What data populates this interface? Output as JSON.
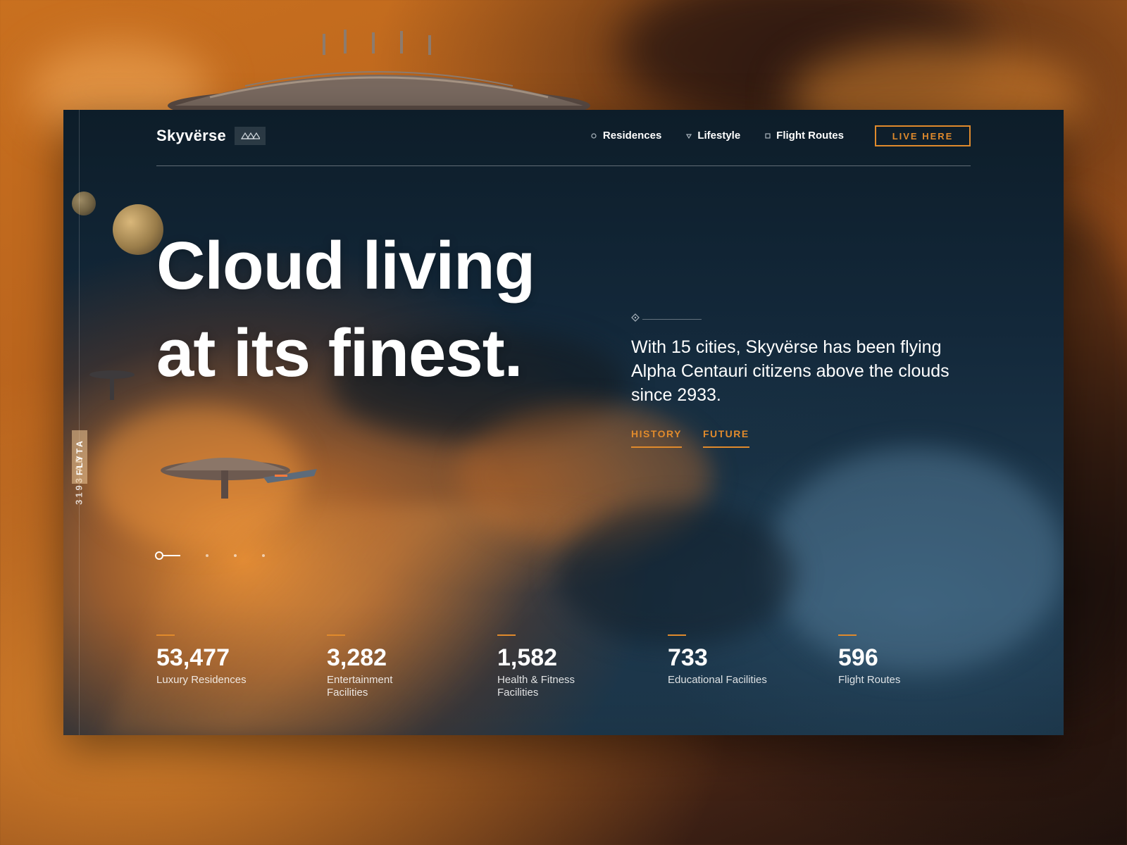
{
  "brand": {
    "name": "Skyvërse",
    "badge_icon": "triangles-icon"
  },
  "nav": {
    "items": [
      {
        "label": "Residences",
        "icon": "circle-icon"
      },
      {
        "label": "Lifestyle",
        "icon": "triangle-down-icon"
      },
      {
        "label": "Flight Routes",
        "icon": "square-icon"
      }
    ],
    "cta_label": "LIVE HERE"
  },
  "side": {
    "year": "3193 AD",
    "tag": "FLYTA"
  },
  "hero": {
    "headline_line1": "Cloud living",
    "headline_line2": "at its finest.",
    "blurb": "With 15 cities, Skyvërse has been flying Alpha Centauri citizens above the clouds since 2933.",
    "links": [
      "HISTORY",
      "FUTURE"
    ]
  },
  "pager": {
    "count": 4,
    "active": 1
  },
  "stats": [
    {
      "value": "53,477",
      "label": "Luxury Residences"
    },
    {
      "value": "3,282",
      "label": "Entertainment Facilities"
    },
    {
      "value": "1,582",
      "label": "Health & Fitness Facilities"
    },
    {
      "value": "733",
      "label": "Educational Facilities"
    },
    {
      "value": "596",
      "label": "Flight Routes"
    }
  ],
  "colors": {
    "accent": "#e08a2c",
    "ink": "#ffffff",
    "deep": "#0d1d29"
  }
}
